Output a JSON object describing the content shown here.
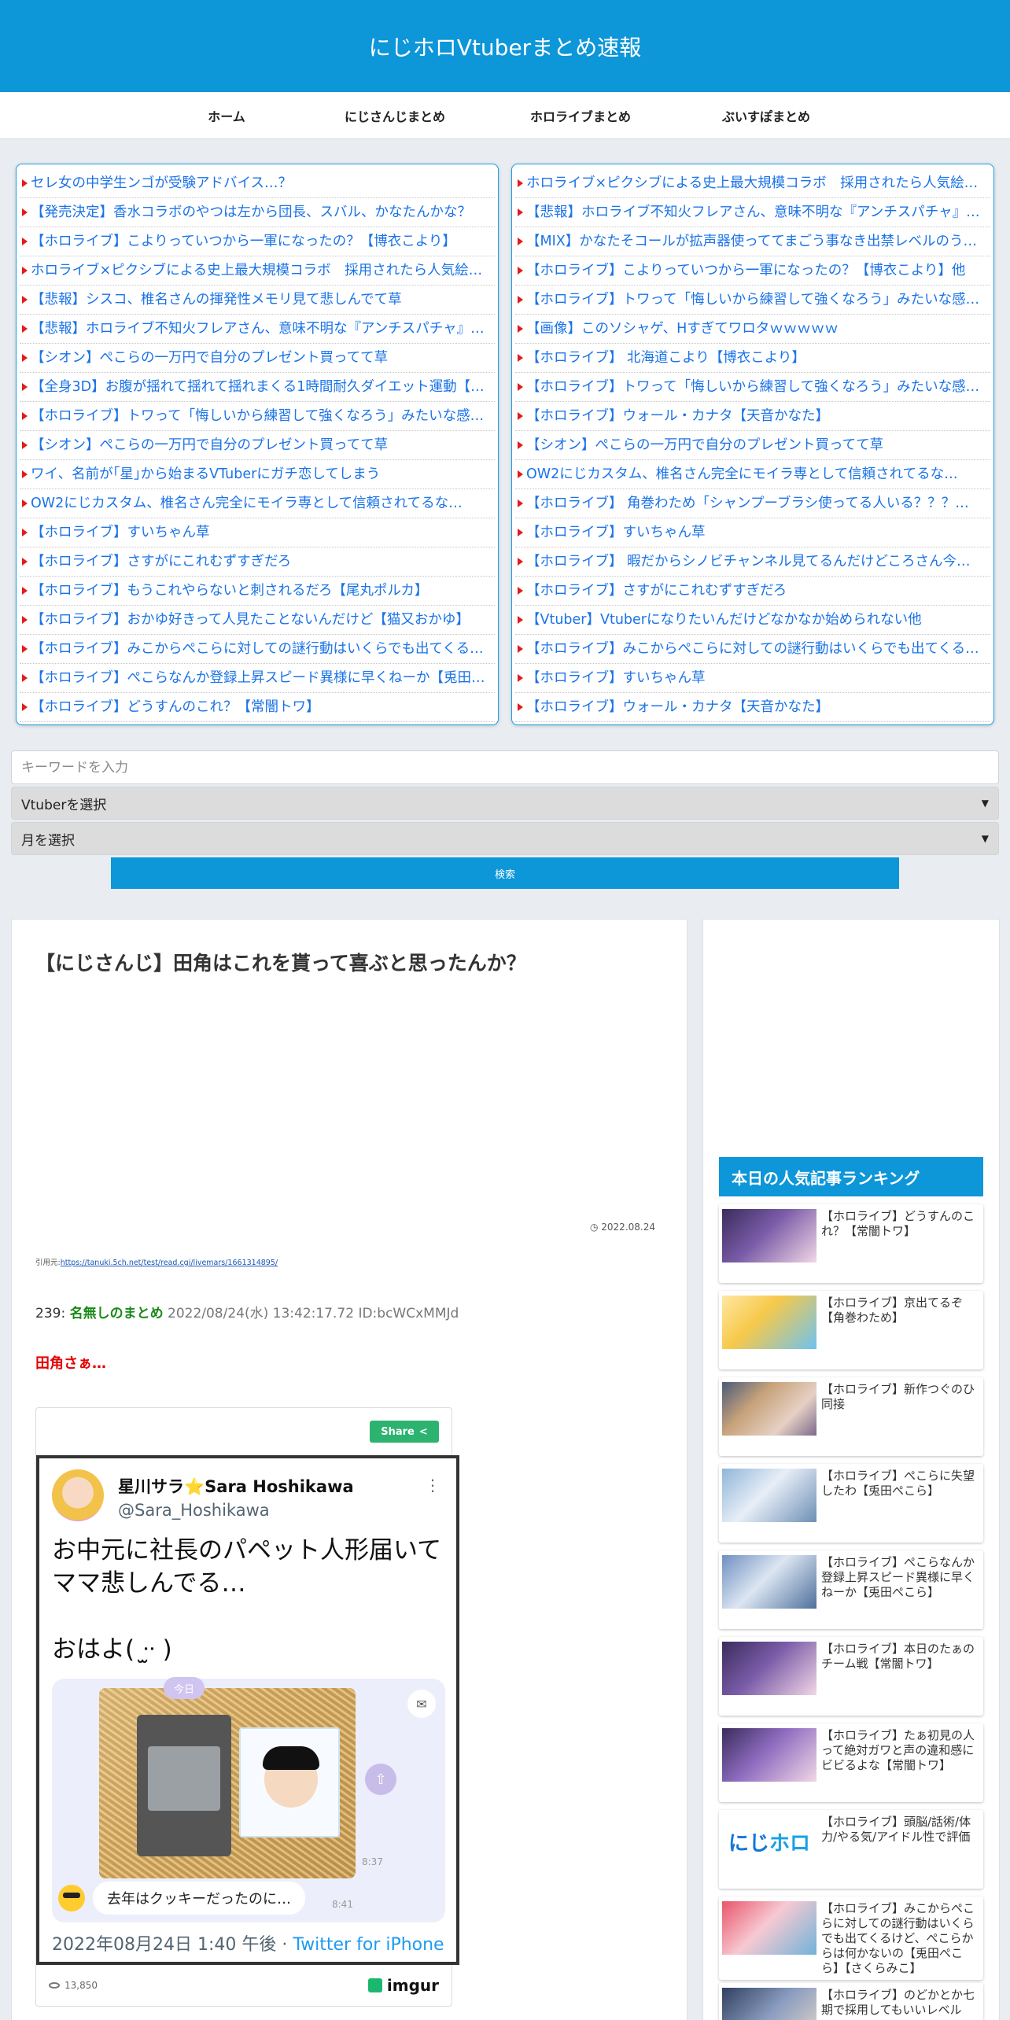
{
  "site": {
    "title": "にじホロVtuberまとめ速報"
  },
  "nav": [
    "ホーム",
    "にじさんじまとめ",
    "ホロライブまとめ",
    "ぶいすぽまとめ"
  ],
  "antenna_left": [
    "セレ女の中学生ンゴが受験アドバイス…？",
    "【発売決定】香水コラボのやつは左から団長、スバル、かなたんかな？",
    "【ホロライブ】こよりっていつから一軍になったの？【博衣こより】",
    "ホロライブ×ピクシブによる史上最大規模コラボ　採用されたら人気絵…",
    "【悲報】シスコ、椎名さんの揮発性メモリ見て悲しんでて草",
    "【悲報】ホロライブ不知火フレアさん、意味不明な『アンチスパチャ』…",
    "【シオン】ぺこらの一万円で自分のプレゼント買ってて草",
    "【全身3D】お腹が揺れて揺れて揺れまくる1時間耐久ダイエット運動【…",
    "【ホロライブ】トワって「悔しいから練習して強くなろう」みたいな感…",
    "【シオン】ぺこらの一万円で自分のプレゼント買ってて草",
    "ワイ、名前が｢星｣から始まるVTuberにガチ恋してしまう",
    "OW2にじカスタム、椎名さん完全にモイラ専として信頼されてるな…",
    "【ホロライブ】すいちゃん草",
    "【ホロライブ】さすがにこれむずすぎだろ",
    "【ホロライブ】もうこれやらないと刺されるだろ【尾丸ポルカ】",
    "【ホロライブ】おかゆ好きって人見たことないんだけど【猫又おかゆ】",
    "【ホロライブ】みこからぺこらに対しての謎行動はいくらでも出てくる…",
    "【ホロライブ】ぺこらなんか登録上昇スピード異様に早くねーか【兎田…",
    "【ホロライブ】どうすんのこれ？【常闇トワ】"
  ],
  "antenna_right": [
    "ホロライブ×ピクシブによる史上最大規模コラボ　採用されたら人気絵…",
    "【悲報】ホロライブ不知火フレアさん、意味不明な『アンチスパチャ』…",
    "【MIX】かなたそコールが拡声器使っててまごう事なき出禁レベルのう…",
    "【ホロライブ】こよりっていつから一軍になったの？【博衣こより】他",
    "【ホロライブ】トワって「悔しいから練習して強くなろう」みたいな感…",
    "【画像】このソシャゲ、Hすぎてワロタｗｗｗｗｗ",
    "【ホロライブ】 北海道こより【博衣こより】",
    "【ホロライブ】トワって「悔しいから練習して強くなろう」みたいな感…",
    "【ホロライブ】ウォール・カナタ【天音かなた】",
    "【シオン】ぺこらの一万円で自分のプレゼント買ってて草",
    "OW2にじカスタム、椎名さん完全にモイラ専として信頼されてるな…",
    "【ホロライブ】 角巻わため「シャンプーブラシ使ってる人いる？？？…",
    "【ホロライブ】すいちゃん草",
    "【ホロライブ】 暇だからシノビチャンネル見てるんだけどころさん今…",
    "【ホロライブ】さすがにこれむずすぎだろ",
    "【Vtuber】Vtuberになりたいんだけどなかなか始められない他",
    "【ホロライブ】みこからぺこらに対しての謎行動はいくらでも出てくる…",
    "【ホロライブ】すいちゃん草",
    "【ホロライブ】ウォール・カナタ【天音かなた】"
  ],
  "search": {
    "keyword_placeholder": "キーワードを入力",
    "vtuber_select": "Vtuberを選択",
    "month_select": "月を選択",
    "button": "検索"
  },
  "article": {
    "title": "【にじさんじ】田角はこれを貰って喜ぶと思ったんか？",
    "date": "2022.08.24",
    "source_prefix": "引用元:",
    "source_url": "https://tanuki.5ch.net/test/read.cgi/livemars/1661314895/",
    "res_num": "239:",
    "res_name": "名無しのまとめ",
    "res_meta": "2022/08/24(水) 13:42:17.72 ID:bcWCxMMJd",
    "res_body": "田角さぁ…"
  },
  "embed": {
    "share": "Share",
    "tweet_name": "星川サラ⭐Sara Hoshikawa",
    "tweet_handle": "@Sara_Hoshikawa",
    "tweet_text": "お中元に社長のパペット人形届いて\nママ悲しんでる…\n\nおはよ( ᐧ̫ᐧ )",
    "today_pill": "今日",
    "time_1": "8:37",
    "chat_message": "去年はクッキーだったのに…",
    "time_2": "8:41",
    "tweet_date": "2022年08月24日 1:40 午後 · ",
    "tweet_via": "Twitter for iPhone",
    "views": "13,850",
    "imgur": "imgur"
  },
  "ranking": {
    "header": "本日の人気記事ランキング",
    "items": [
      "【ホロライブ】どうすんのこれ？【常闇トワ】",
      "【ホロライブ】京出てるぞ【角巻わため】",
      "【ホロライブ】新作つぐのひ同接",
      "【ホロライブ】ぺこらに失望したわ【兎田ぺこら】",
      "【ホロライブ】ぺこらなんか登録上昇スピード異様に早くねーか【兎田ぺこら】",
      "【ホロライブ】本日のたぁのチーム戦【常闇トワ】",
      "【ホロライブ】たぁ初見の人って絶対ガワと声の違和感にビビるよな【常闇トワ】",
      "【ホロライブ】頭脳/話術/体力/やる気/アイドル性で評価",
      "【ホロライブ】みこからぺこらに対しての謎行動はいくらでも出てくるけど、ぺこらからは何かないの【兎田ぺこら】【さくらみこ】",
      "【ホロライブ】のどかとか七期で採用してもいいレベル"
    ],
    "thumb_logo_a": "にじ",
    "thumb_logo_b": "ホロ"
  },
  "colors": {
    "brand": "#0d96d8",
    "link": "#1a73e8",
    "accent_red": "#e60000",
    "name_green": "#1a8a1a"
  }
}
